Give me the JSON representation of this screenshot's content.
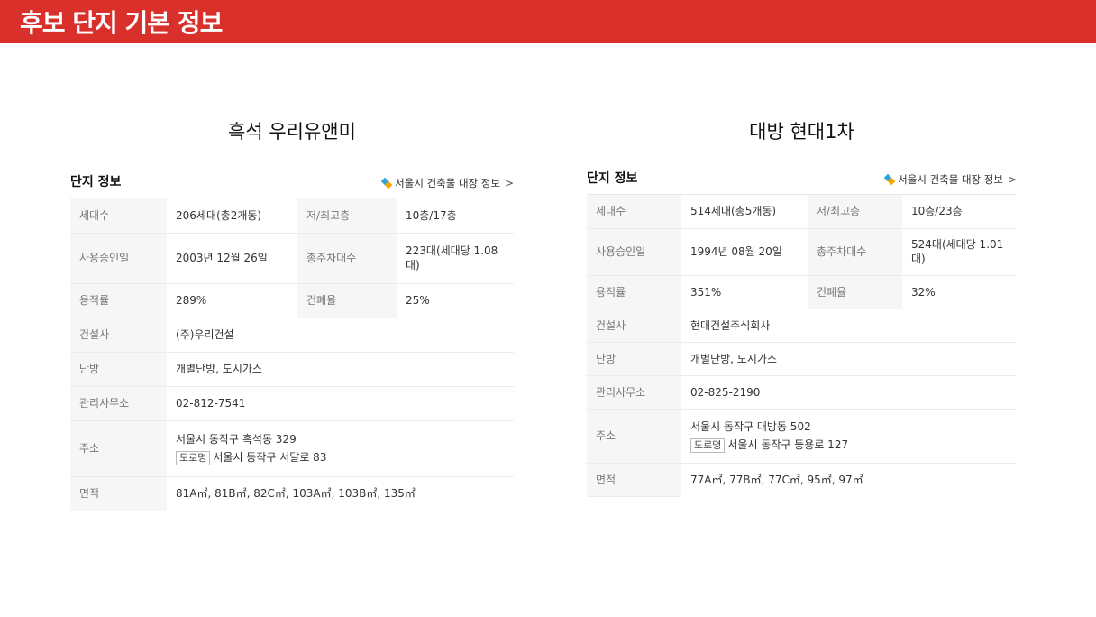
{
  "header": {
    "title": "후보 단지 기본 정보"
  },
  "icons": {
    "building_link": "building-registry-icon",
    "chevron": "chevron-right-icon"
  },
  "colors": {
    "header_bg": "#d9302c",
    "label_bg": "#f6f6f6"
  },
  "complexes": [
    {
      "name": "흑석 우리유앤미",
      "section_title": "단지 정보",
      "building_link": "서울시 건축물 대장 정보",
      "chevron": ">",
      "households_label": "세대수",
      "households": "206세대(총2개동)",
      "floors_label": "저/최고층",
      "floors": "10층/17층",
      "approval_label": "사용승인일",
      "approval": "2003년 12월 26일",
      "parking_label": "총주차대수",
      "parking": "223대(세대당 1.08대)",
      "far_label": "용적률",
      "far": "289%",
      "bcr_label": "건폐율",
      "bcr": "25%",
      "builder_label": "건설사",
      "builder": "(주)우리건설",
      "heating_label": "난방",
      "heating": "개별난방, 도시가스",
      "office_label": "관리사무소",
      "office": "02-812-7541",
      "address_label": "주소",
      "address_lot": "서울시 동작구 흑석동 329",
      "road_tag": "도로명",
      "address_road": "서울시 동작구 서달로 83",
      "area_label": "면적",
      "area": "81A㎡, 81B㎡, 82C㎡, 103A㎡, 103B㎡, 135㎡"
    },
    {
      "name": "대방 현대1차",
      "section_title": "단지 정보",
      "building_link": "서울시 건축물 대장 정보",
      "chevron": ">",
      "households_label": "세대수",
      "households": "514세대(총5개동)",
      "floors_label": "저/최고층",
      "floors": "10층/23층",
      "approval_label": "사용승인일",
      "approval": "1994년 08월 20일",
      "parking_label": "총주차대수",
      "parking": "524대(세대당 1.01대)",
      "far_label": "용적률",
      "far": "351%",
      "bcr_label": "건폐율",
      "bcr": "32%",
      "builder_label": "건설사",
      "builder": "현대건설주식회사",
      "heating_label": "난방",
      "heating": "개별난방, 도시가스",
      "office_label": "관리사무소",
      "office": "02-825-2190",
      "address_label": "주소",
      "address_lot": "서울시 동작구 대방동 502",
      "road_tag": "도로명",
      "address_road": "서울시 동작구 등용로 127",
      "area_label": "면적",
      "area": "77A㎡, 77B㎡, 77C㎡, 95㎡, 97㎡"
    }
  ]
}
